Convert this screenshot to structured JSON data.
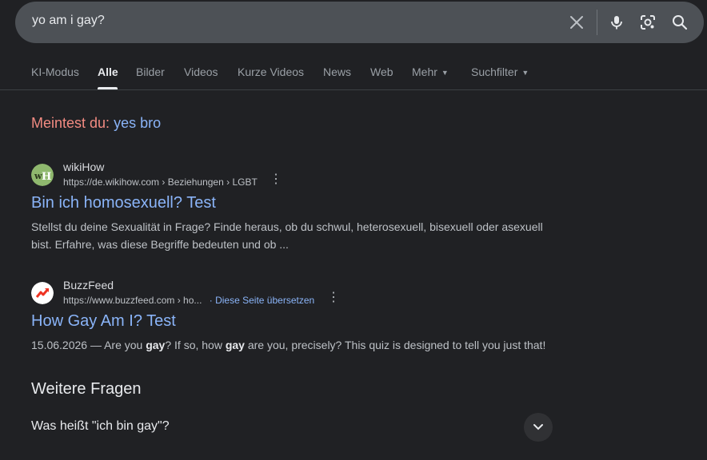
{
  "search": {
    "query": "yo am i gay?"
  },
  "tabs": [
    {
      "label": "KI-Modus"
    },
    {
      "label": "Alle"
    },
    {
      "label": "Bilder"
    },
    {
      "label": "Videos"
    },
    {
      "label": "Kurze Videos"
    },
    {
      "label": "News"
    },
    {
      "label": "Web"
    },
    {
      "label": "Mehr"
    },
    {
      "label": "Suchfilter"
    }
  ],
  "did_you_mean": {
    "label": "Meintest du:",
    "suggestion": "yes bro"
  },
  "results": [
    {
      "site_name": "wikiHow",
      "url": "https://de.wikihow.com › Beziehungen › LGBT",
      "title": "Bin ich homosexuell? Test",
      "snippet_line1": "Stellst du deine Sexualität in Frage? Finde heraus, ob du schwul, heterosexuell, bisexuell oder asexuell",
      "snippet_line2": "bist. Erfahre, was diese Begriffe bedeuten und ob ..."
    },
    {
      "site_name": "BuzzFeed",
      "url": "https://www.buzzfeed.com › ho...",
      "translate": "· Diese Seite übersetzen",
      "title": "How Gay Am I? Test",
      "snippet_a": "15.06.2026 — Are you ",
      "snippet_bold1": "gay",
      "snippet_b": "? If so, how ",
      "snippet_bold2": "gay",
      "snippet_c": " are you, precisely? This quiz is designed to tell you just that!"
    }
  ],
  "more_questions": {
    "heading": "Weitere Fragen",
    "items": [
      {
        "question": "Was heißt \"ich bin gay\"?"
      }
    ]
  },
  "colors": {
    "background": "#202124",
    "link": "#8ab4f8",
    "did_you_mean_label": "#f28b82"
  }
}
